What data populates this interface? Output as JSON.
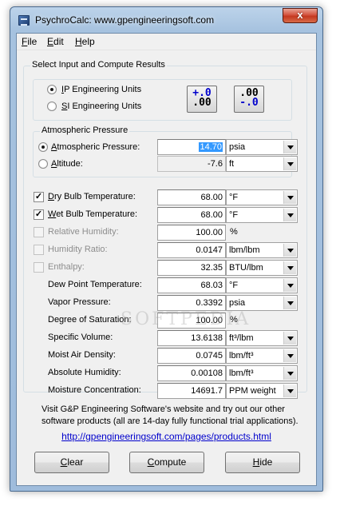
{
  "window": {
    "title": "PsychroCalc:  www.gpengineeringsoft.com",
    "close_glyph": "x"
  },
  "menu": [
    {
      "label": "File",
      "mnemonic": "F",
      "rest": "ile"
    },
    {
      "label": "Edit",
      "mnemonic": "E",
      "rest": "dit"
    },
    {
      "label": "Help",
      "mnemonic": "H",
      "rest": "elp"
    }
  ],
  "main_group": {
    "title": "Select Input and Compute Results"
  },
  "units": {
    "ip": {
      "label": "IP Engineering Units",
      "mnemonic": "I",
      "rest": "P Engineering Units",
      "selected": true
    },
    "si": {
      "label": "SI Engineering Units",
      "mnemonic": "S",
      "rest": "I Engineering Units",
      "selected": false
    },
    "btn_ip": {
      "top": "+.0",
      "bottom": ".00"
    },
    "btn_si": {
      "top": ".00",
      "bottom": "-.0"
    }
  },
  "atmo": {
    "title": "Atmospheric Pressure",
    "pressure": {
      "label": "Atmospheric Pressure:",
      "mnemonic": "A",
      "rest": "tmospheric Pressure:",
      "value": "14.70",
      "unit": "psia",
      "selected": true
    },
    "altitude": {
      "label": "Altitude:",
      "mnemonic": "A",
      "rest": "ltitude:",
      "value": "-7.6",
      "unit": "ft",
      "selected": false
    }
  },
  "rows": [
    {
      "label": "Dry Bulb Temperature:",
      "mnemonic": "D",
      "rest": "ry Bulb Temperature:",
      "checkbox": true,
      "checked": true,
      "disabled": false,
      "value": "68.00",
      "unit": "°F",
      "unit_combo": true
    },
    {
      "label": "Wet Bulb Temperature:",
      "mnemonic": "W",
      "rest": "et Bulb Temperature:",
      "checkbox": true,
      "checked": true,
      "disabled": false,
      "value": "68.00",
      "unit": "°F",
      "unit_combo": true
    },
    {
      "label": "Relative Humidity:",
      "mnemonic": "",
      "rest": "Relative Humidity:",
      "checkbox": true,
      "checked": false,
      "disabled": true,
      "value": "100.00",
      "unit": "%",
      "unit_combo": false
    },
    {
      "label": "Humidity Ratio:",
      "mnemonic": "",
      "rest": "Humidity Ratio:",
      "checkbox": true,
      "checked": false,
      "disabled": true,
      "value": "0.0147",
      "unit": "lbm/lbm",
      "unit_combo": true
    },
    {
      "label": "Enthalpy:",
      "mnemonic": "",
      "rest": "Enthalpy:",
      "checkbox": true,
      "checked": false,
      "disabled": true,
      "value": "32.35",
      "unit": "BTU/lbm",
      "unit_combo": true
    },
    {
      "label": "Dew Point Temperature:",
      "mnemonic": "",
      "rest": "Dew Point Temperature:",
      "checkbox": false,
      "value": "68.03",
      "unit": "°F",
      "unit_combo": true
    },
    {
      "label": "Vapor Pressure:",
      "mnemonic": "",
      "rest": "Vapor Pressure:",
      "checkbox": false,
      "value": "0.3392",
      "unit": "psia",
      "unit_combo": true
    },
    {
      "label": "Degree of Saturation:",
      "mnemonic": "",
      "rest": "Degree of Saturation:",
      "checkbox": false,
      "value": "100.00",
      "unit": "%",
      "unit_combo": false
    },
    {
      "label": "Specific Volume:",
      "mnemonic": "",
      "rest": "Specific Volume:",
      "checkbox": false,
      "value": "13.6138",
      "unit": "ft³/lbm",
      "unit_combo": true
    },
    {
      "label": "Moist Air Density:",
      "mnemonic": "",
      "rest": "Moist Air Density:",
      "checkbox": false,
      "value": "0.0745",
      "unit": "lbm/ft³",
      "unit_combo": true
    },
    {
      "label": "Absolute Humidity:",
      "mnemonic": "",
      "rest": "Absolute Humidity:",
      "checkbox": false,
      "value": "0.00108",
      "unit": "lbm/ft³",
      "unit_combo": true
    },
    {
      "label": "Moisture Concentration:",
      "mnemonic": "",
      "rest": "Moisture Concentration:",
      "checkbox": false,
      "value": "14691.7",
      "unit": "PPM weight",
      "unit_combo": true
    }
  ],
  "info_text": "Visit G&P Engineering Software's website and try out our other software products (all are 14-day fully functional trial applications).",
  "link": "http://gpengineeringsoft.com/pages/products.html",
  "buttons": [
    {
      "label": "Clear",
      "mnemonic": "C",
      "rest": "lear"
    },
    {
      "label": "Compute",
      "mnemonic": "C",
      "rest": "ompute"
    },
    {
      "label": "Hide",
      "mnemonic": "H",
      "rest": "ide"
    }
  ],
  "watermark": "SOFTPEDIA"
}
